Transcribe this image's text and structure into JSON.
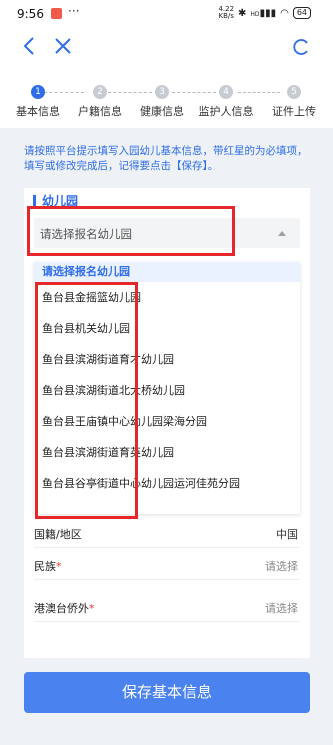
{
  "status_bar": {
    "time": "9:56",
    "dots": "···",
    "net_speed_value": "4.22",
    "net_speed_unit": "KB/s",
    "signal": "HD",
    "battery": "64"
  },
  "nav": {
    "back_icon": "chevron-left-icon",
    "close_icon": "close-icon",
    "refresh_icon": "refresh-icon"
  },
  "steps": [
    {
      "number": "1",
      "label": "基本信息",
      "active": true
    },
    {
      "number": "2",
      "label": "户籍信息",
      "active": false
    },
    {
      "number": "3",
      "label": "健康信息",
      "active": false
    },
    {
      "number": "4",
      "label": "监护人信息",
      "active": false
    },
    {
      "number": "5",
      "label": "证件上传",
      "active": false
    }
  ],
  "tip": "请按照平台提示填写入园幼儿基本信息，带红星的为必填项，填写或修改完成后，记得要点击【保存】。",
  "section": {
    "title": "幼儿园",
    "select_placeholder": "请选择报名幼儿园"
  },
  "dropdown": {
    "header": "请选择报名幼儿园",
    "items": [
      "鱼台县金摇篮幼儿园",
      "鱼台县机关幼儿园",
      "鱼台县滨湖街道育才幼儿园",
      "鱼台县滨湖街道北大桥幼儿园",
      "鱼台县王庙镇中心幼儿园梁海分园",
      "鱼台县滨湖街道育英幼儿园",
      "鱼台县谷亭街道中心幼儿园运河佳苑分园"
    ]
  },
  "form": {
    "nationality_label": "国籍/地区",
    "nationality_value": "中国",
    "ethnicity_label": "民族",
    "ethnicity_value": "请选择",
    "overseas_label": "港澳台侨外",
    "overseas_value": "请选择",
    "required_mark": "*"
  },
  "save_button": "保存基本信息",
  "colors": {
    "accent": "#2f6dea",
    "button": "#4a82f0",
    "annotation_red": "#e5262b",
    "required": "#e53935"
  }
}
